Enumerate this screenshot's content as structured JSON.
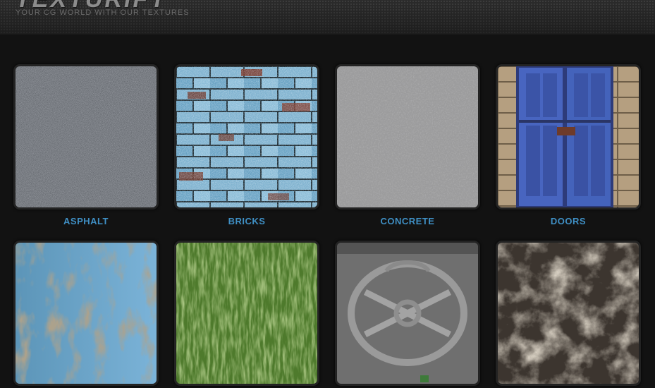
{
  "site": {
    "logo": "TEXTURIFY",
    "tagline": "YOUR CG WORLD WITH OUR TEXTURES"
  },
  "colors": {
    "background": "#121212",
    "label": "#3f8fc4",
    "tile_border": "#232323"
  },
  "categories": [
    {
      "label": "ASPHALT"
    },
    {
      "label": "BRICKS"
    },
    {
      "label": "CONCRETE"
    },
    {
      "label": "DOORS"
    },
    {
      "label": ""
    },
    {
      "label": ""
    },
    {
      "label": ""
    },
    {
      "label": ""
    }
  ]
}
